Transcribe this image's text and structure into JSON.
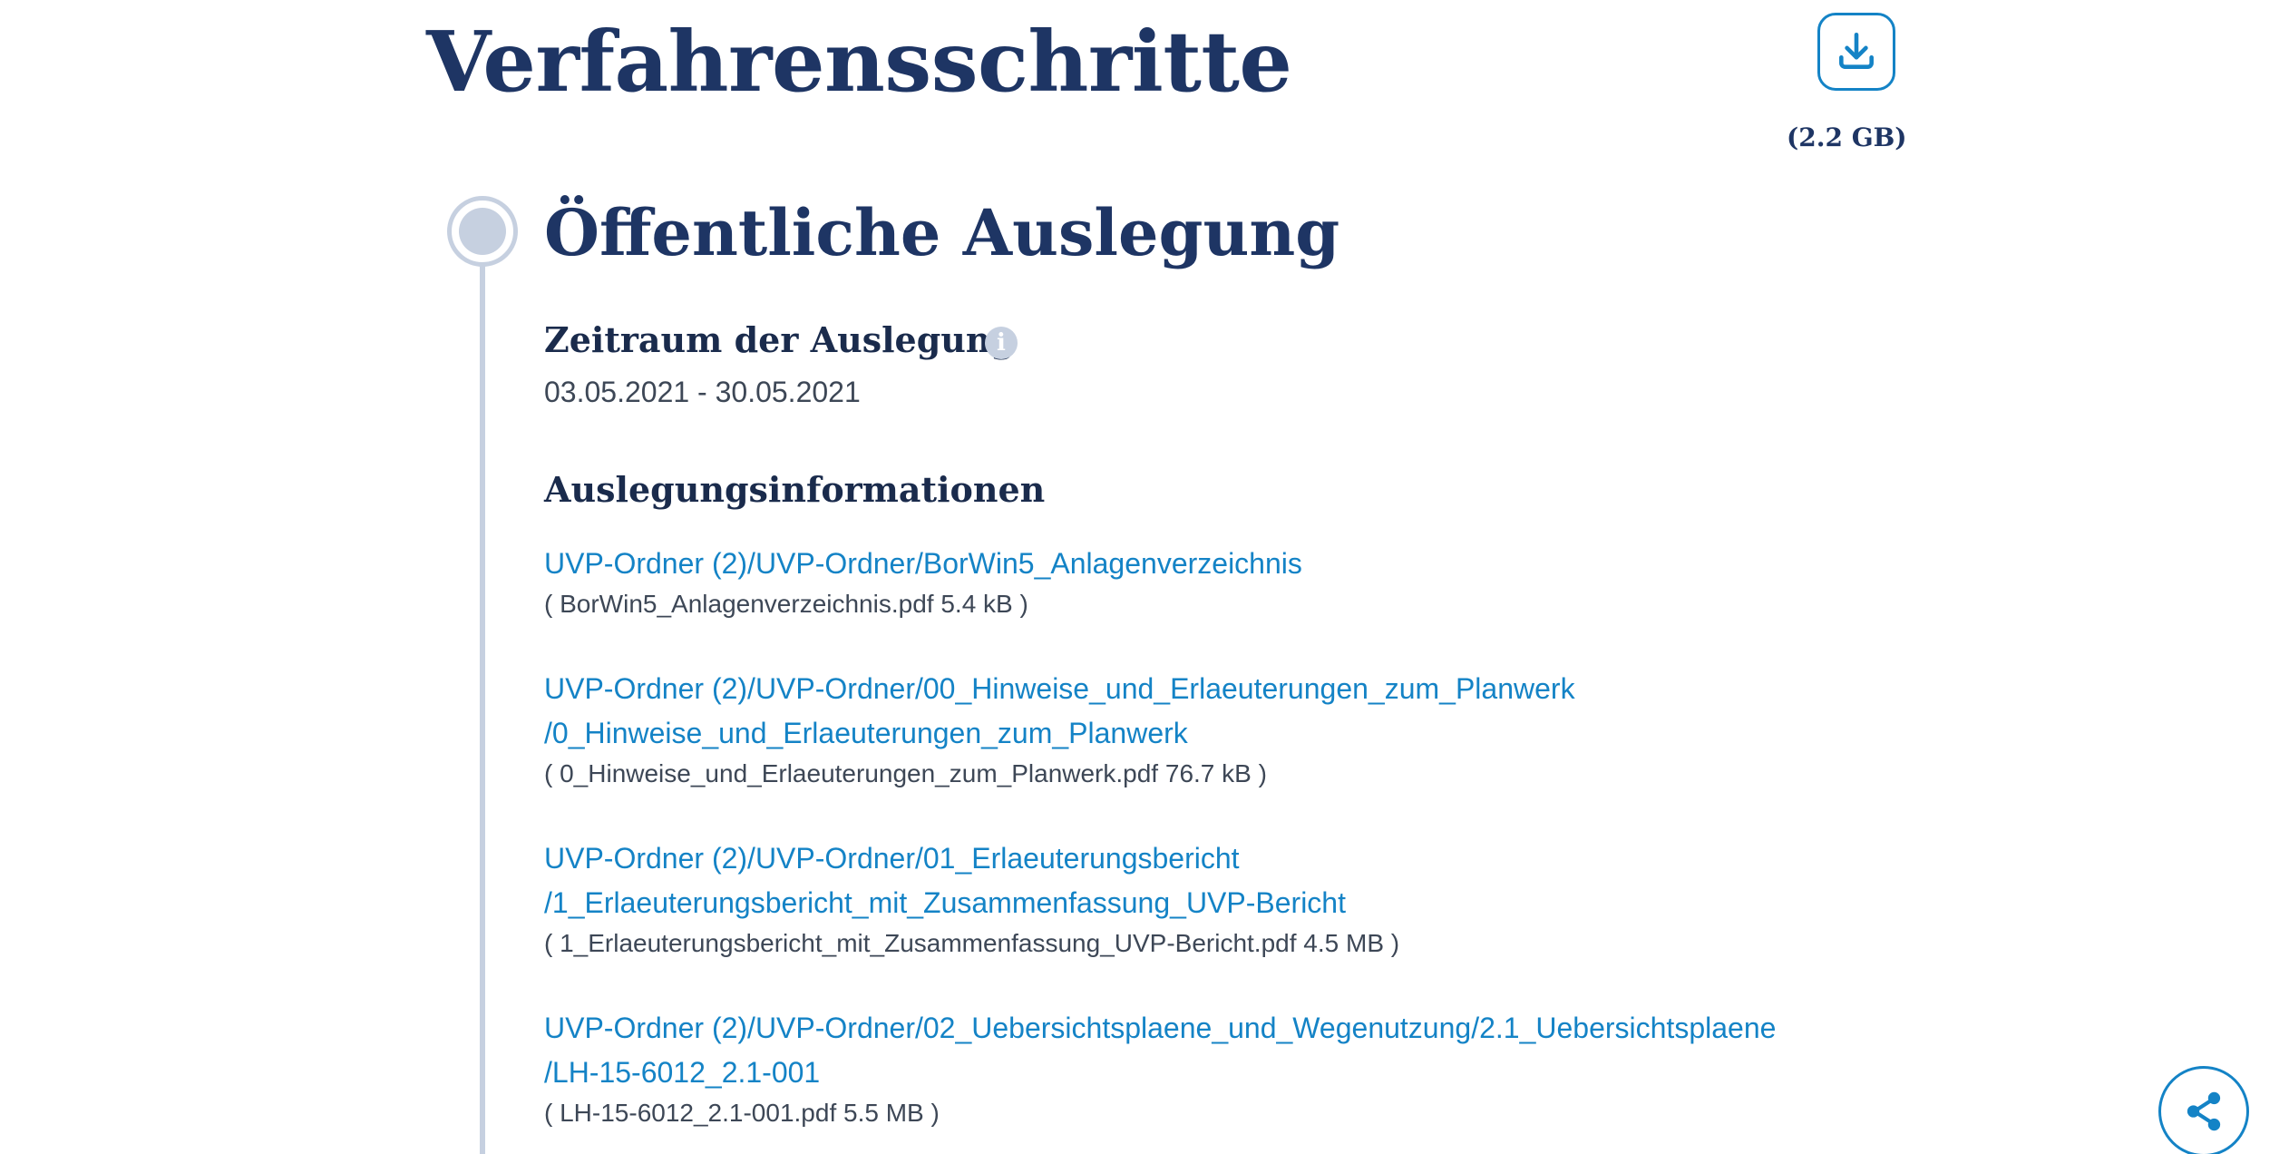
{
  "page": {
    "title": "Verfahrensschritte"
  },
  "download": {
    "icon": "download-icon",
    "size_label": "(2.2 GB)"
  },
  "step": {
    "title": "Öffentliche Auslegung",
    "period": {
      "heading": "Zeitraum der Auslegung",
      "info_icon": "i",
      "value": "03.05.2021 - 30.05.2021"
    },
    "info": {
      "heading": "Auslegungsinformationen",
      "documents": [
        {
          "link_line1": "UVP-Ordner (2)/UVP-Ordner/BorWin5_Anlagenverzeichnis",
          "link_line2": "",
          "meta": "( BorWin5_Anlagenverzeichnis.pdf 5.4 kB )"
        },
        {
          "link_line1": "UVP-Ordner (2)/UVP-Ordner/00_Hinweise_und_Erlaeuterungen_zum_Planwerk",
          "link_line2": "/0_Hinweise_und_Erlaeuterungen_zum_Planwerk",
          "meta": "( 0_Hinweise_und_Erlaeuterungen_zum_Planwerk.pdf 76.7 kB )"
        },
        {
          "link_line1": "UVP-Ordner (2)/UVP-Ordner/01_Erlaeuterungsbericht",
          "link_line2": "/1_Erlaeuterungsbericht_mit_Zusammenfassung_UVP-Bericht",
          "meta": "( 1_Erlaeuterungsbericht_mit_Zusammenfassung_UVP-Bericht.pdf 4.5 MB )"
        },
        {
          "link_line1": "UVP-Ordner (2)/UVP-Ordner/02_Uebersichtsplaene_und_Wegenutzung/2.1_Uebersichtsplaene",
          "link_line2": "/LH-15-6012_2.1-001",
          "meta": "( LH-15-6012_2.1-001.pdf 5.5 MB )"
        }
      ]
    }
  },
  "share": {
    "icon": "share-icon"
  },
  "colors": {
    "heading": "#1e3564",
    "link": "#1483c6",
    "muted": "#3d4756",
    "timeline": "#c6d0e0"
  }
}
